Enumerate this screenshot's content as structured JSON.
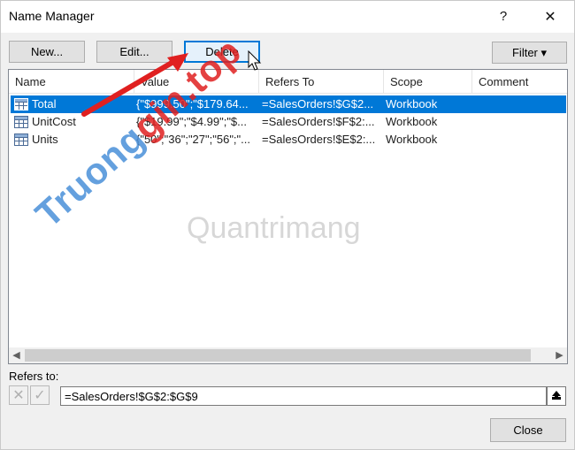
{
  "window": {
    "title": "Name Manager",
    "help_label": "?",
    "close_glyph": "✕"
  },
  "toolbar": {
    "new_label": "New...",
    "edit_label": "Edit...",
    "delete_label": "Delete",
    "filter_label": "Filter ▾"
  },
  "table": {
    "columns": [
      "Name",
      "Value",
      "Refers To",
      "Scope",
      "Comment"
    ],
    "rows": [
      {
        "name": "Total",
        "value": "{\"$999.50\";\"$179.64...",
        "refers_to": "=SalesOrders!$G$2...",
        "scope": "Workbook",
        "comment": "",
        "selected": true
      },
      {
        "name": "UnitCost",
        "value": "{\"$19.99\";\"$4.99\";\"$...",
        "refers_to": "=SalesOrders!$F$2:...",
        "scope": "Workbook",
        "comment": "",
        "selected": false
      },
      {
        "name": "Units",
        "value": "{\"50\";\"36\";\"27\";\"56\";\"...",
        "refers_to": "=SalesOrders!$E$2:...",
        "scope": "Workbook",
        "comment": "",
        "selected": false
      }
    ]
  },
  "refers": {
    "label": "Refers to:",
    "value": "=SalesOrders!$G$2:$G$9"
  },
  "footer": {
    "close_label": "Close"
  },
  "watermark": {
    "text_a": "Truong",
    "text_b": "gin.top",
    "text_c": "Quantrimang"
  },
  "colors": {
    "selection": "#0078d7",
    "accent_arrow": "#e02020"
  }
}
